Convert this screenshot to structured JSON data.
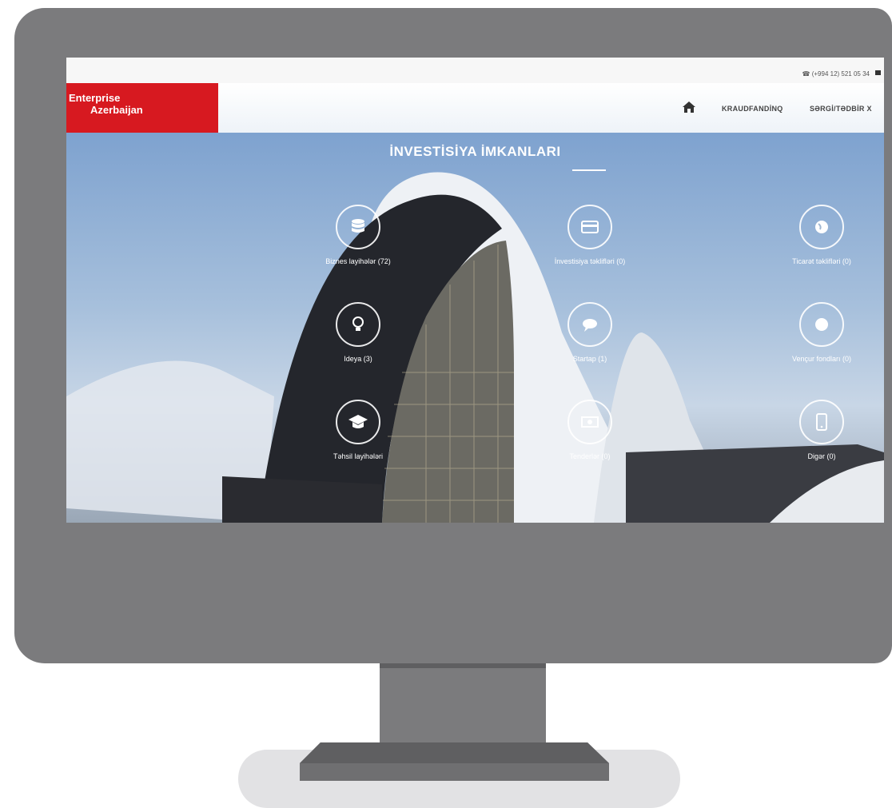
{
  "topbar": {
    "phone": "☎ (+994 12) 521 05 34"
  },
  "logo": {
    "line1": "Enterprise",
    "line2": "Azerbaijan"
  },
  "nav": {
    "items": [
      "KRAUDFANDİNQ",
      "SƏRGİ/TƏDBİR X"
    ]
  },
  "hero": {
    "title": "İNVESTİSİYA İMKANLARI",
    "features": [
      {
        "label": "Biznes layihələr (72)",
        "icon": "database-icon"
      },
      {
        "label": "Ideya (3)",
        "icon": "lightbulb-icon"
      },
      {
        "label": "Təhsil layihələri",
        "icon": "graduation-cap-icon"
      },
      {
        "label": "İnvestisiya təklifləri (0)",
        "icon": "card-icon"
      },
      {
        "label": "Startap (1)",
        "icon": "chat-icon"
      },
      {
        "label": "Tenderlər (0)",
        "icon": "money-icon"
      },
      {
        "label": "Ticarət təklifləri (0)",
        "icon": "globe-icon"
      },
      {
        "label": "Vençur fondları (0)",
        "icon": "circle-icon"
      },
      {
        "label": "Digər (0)",
        "icon": "tablet-icon"
      }
    ]
  },
  "colors": {
    "brand": "#d71920",
    "frame": "#7b7b7d"
  }
}
